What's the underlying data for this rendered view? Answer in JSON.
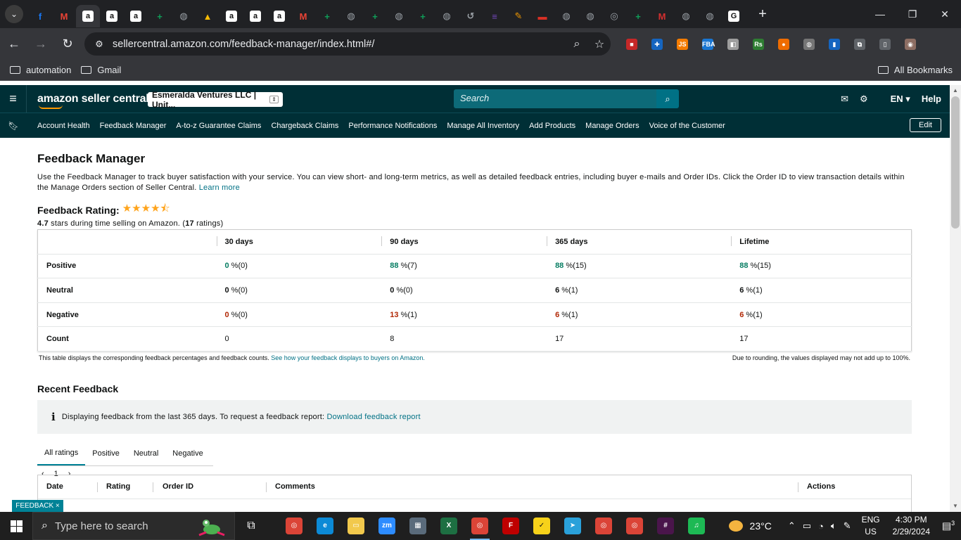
{
  "browser": {
    "url": "sellercentral.amazon.com/feedback-manager/index.html#/",
    "tabs": [
      {
        "icon": "facebook-icon",
        "color": "#1877f2",
        "glyph": "f"
      },
      {
        "icon": "gmail-icon",
        "color": "#ea4335",
        "glyph": "M"
      },
      {
        "icon": "amazon-icon",
        "color": "#ffffff",
        "glyph": "a",
        "active": true
      },
      {
        "icon": "amazon-icon",
        "color": "#ffffff",
        "glyph": "a"
      },
      {
        "icon": "amazon-icon",
        "color": "#ffffff",
        "glyph": "a"
      },
      {
        "icon": "sheets-icon",
        "color": "#0f9d58",
        "glyph": "+"
      },
      {
        "icon": "globe-icon",
        "color": "#9aa0a6",
        "glyph": "◍"
      },
      {
        "icon": "drive-icon",
        "color": "#fbbc04",
        "glyph": "▲"
      },
      {
        "icon": "amazon-icon",
        "color": "#ffffff",
        "glyph": "a"
      },
      {
        "icon": "amazon-icon",
        "color": "#ffffff",
        "glyph": "a"
      },
      {
        "icon": "amazon-icon",
        "color": "#ffffff",
        "glyph": "a"
      },
      {
        "icon": "gmail-icon",
        "color": "#ea4335",
        "glyph": "M"
      },
      {
        "icon": "sheets-icon",
        "color": "#0f9d58",
        "glyph": "+"
      },
      {
        "icon": "globe-icon",
        "color": "#9aa0a6",
        "glyph": "◍"
      },
      {
        "icon": "sheets-icon",
        "color": "#0f9d58",
        "glyph": "+"
      },
      {
        "icon": "globe-icon",
        "color": "#9aa0a6",
        "glyph": "◍"
      },
      {
        "icon": "sheets-icon",
        "color": "#0f9d58",
        "glyph": "+"
      },
      {
        "icon": "globe-icon",
        "color": "#9aa0a6",
        "glyph": "◍"
      },
      {
        "icon": "history-icon",
        "color": "#9aa0a6",
        "glyph": "↺"
      },
      {
        "icon": "forms-icon",
        "color": "#7248b9",
        "glyph": "≡"
      },
      {
        "icon": "tool-icon",
        "color": "#f29900",
        "glyph": "✎"
      },
      {
        "icon": "flag-icon",
        "color": "#d93025",
        "glyph": "▬"
      },
      {
        "icon": "globe-icon",
        "color": "#9aa0a6",
        "glyph": "◍"
      },
      {
        "icon": "globe-icon",
        "color": "#9aa0a6",
        "glyph": "◍"
      },
      {
        "icon": "chrome-icon",
        "color": "#9aa0a6",
        "glyph": "◎"
      },
      {
        "icon": "sheets-icon",
        "color": "#0f9d58",
        "glyph": "+"
      },
      {
        "icon": "mail-m-icon",
        "color": "#d32f2f",
        "glyph": "M"
      },
      {
        "icon": "globe-icon",
        "color": "#9aa0a6",
        "glyph": "◍"
      },
      {
        "icon": "globe-icon",
        "color": "#9aa0a6",
        "glyph": "◍"
      },
      {
        "icon": "google-icon",
        "color": "#ffffff",
        "glyph": "G"
      }
    ],
    "extensions": [
      {
        "icon": "ext-red-icon",
        "color": "#c62828",
        "glyph": "■"
      },
      {
        "icon": "ext-blue-icon",
        "color": "#1565c0",
        "glyph": "✚"
      },
      {
        "icon": "ext-js-icon",
        "color": "#f57c00",
        "glyph": "JS"
      },
      {
        "icon": "ext-fba-icon",
        "color": "#1976d2",
        "glyph": "FBA"
      },
      {
        "icon": "ext-doc-icon",
        "color": "#9e9e9e",
        "glyph": "◧"
      },
      {
        "icon": "ext-rs-icon",
        "color": "#2e7d32",
        "glyph": "Rs"
      },
      {
        "icon": "ext-orange-icon",
        "color": "#ef6c00",
        "glyph": "●"
      },
      {
        "icon": "ext-globe-icon",
        "color": "#757575",
        "glyph": "◍"
      },
      {
        "icon": "ext-chart-icon",
        "color": "#1565c0",
        "glyph": "▮"
      },
      {
        "icon": "extensions-puzzle-icon",
        "color": "#5f6368",
        "glyph": "⧉"
      },
      {
        "icon": "sidepanel-icon",
        "color": "#5f6368",
        "glyph": "▯"
      },
      {
        "icon": "profile-avatar-icon",
        "color": "#8d6e63",
        "glyph": "◉"
      }
    ],
    "bookmarks": [
      "automation",
      "Gmail"
    ],
    "all_bookmarks": "All Bookmarks"
  },
  "header": {
    "logo": "amazon seller central",
    "account": "Esmeralda Ventures LLC | Unit...",
    "search_placeholder": "Search",
    "lang": "EN",
    "help": "Help"
  },
  "nav": {
    "links": [
      "Account Health",
      "Feedback Manager",
      "A-to-z Guarantee Claims",
      "Chargeback Claims",
      "Performance Notifications",
      "Manage All Inventory",
      "Add Products",
      "Manage Orders",
      "Voice of the Customer"
    ],
    "edit": "Edit"
  },
  "page": {
    "title": "Feedback Manager",
    "intro": "Use the Feedback Manager to track buyer satisfaction with your service. You can view short- and long-term metrics, as well as detailed feedback entries, including buyer e-mails and Order IDs. Click the Order ID to view transaction details within the Manage Orders section of Seller Central.",
    "learn_more": "Learn more",
    "rating_label": "Feedback Rating:",
    "rating_stars": 4.5,
    "rating_value": "4.7",
    "rating_text_mid": " stars during time selling on Amazon. (",
    "rating_count": "17",
    "rating_text_end": " ratings)"
  },
  "summary": {
    "columns": [
      "30 days",
      "90 days",
      "365 days",
      "Lifetime"
    ],
    "rows": [
      {
        "label": "Positive",
        "tone": "g",
        "cells": [
          [
            "0",
            " %(0)"
          ],
          [
            "88",
            " %(7)"
          ],
          [
            "88",
            " %(15)"
          ],
          [
            "88",
            " %(15)"
          ]
        ]
      },
      {
        "label": "Neutral",
        "tone": "k",
        "cells": [
          [
            "0",
            " %(0)"
          ],
          [
            "0",
            " %(0)"
          ],
          [
            "6",
            " %(1)"
          ],
          [
            "6",
            " %(1)"
          ]
        ]
      },
      {
        "label": "Negative",
        "tone": "r",
        "cells": [
          [
            "0",
            " %(0)"
          ],
          [
            "13",
            " %(1)"
          ],
          [
            "6",
            " %(1)"
          ],
          [
            "6",
            " %(1)"
          ]
        ]
      },
      {
        "label": "Count",
        "tone": "plain",
        "cells": [
          [
            "0",
            ""
          ],
          [
            "8",
            ""
          ],
          [
            "17",
            ""
          ],
          [
            "17",
            ""
          ]
        ]
      }
    ],
    "note_left": "This table displays the corresponding feedback percentages and feedback counts.",
    "note_link": "See how your feedback displays to buyers on Amazon.",
    "note_right": "Due to rounding, the values displayed may not add up to 100%."
  },
  "recent": {
    "title": "Recent Feedback",
    "info": "Displaying feedback from the last 365 days. To request a feedback report:",
    "info_link": "Download feedback report",
    "tabs": [
      "All ratings",
      "Positive",
      "Neutral",
      "Negative"
    ],
    "page": "1",
    "columns": [
      "Date",
      "Rating",
      "Order ID",
      "Comments",
      "Actions"
    ]
  },
  "badge": "FEEDBACK ×",
  "taskbar": {
    "search": "Type here to search",
    "apps": [
      {
        "icon": "chrome-icon",
        "color": "#db4437",
        "glyph": "◎"
      },
      {
        "icon": "edge-icon",
        "color": "#0c8ad6",
        "glyph": "e"
      },
      {
        "icon": "explorer-icon",
        "color": "#f2c94c",
        "glyph": "▭"
      },
      {
        "icon": "zoom-icon",
        "color": "#2d8cff",
        "glyph": "zm"
      },
      {
        "icon": "calculator-icon",
        "color": "#5a6b7b",
        "glyph": "▦"
      },
      {
        "icon": "excel-icon",
        "color": "#1d6f42",
        "glyph": "X"
      },
      {
        "icon": "chrome-profile-icon",
        "color": "#db4437",
        "glyph": "◎",
        "on": true
      },
      {
        "icon": "filezilla-icon",
        "color": "#bf0000",
        "glyph": "F"
      },
      {
        "icon": "sticky-notes-icon",
        "color": "#f7d21a",
        "glyph": "✓"
      },
      {
        "icon": "telegram-icon",
        "color": "#2aa1da",
        "glyph": "➤"
      },
      {
        "icon": "chrome-profile-icon",
        "color": "#db4437",
        "glyph": "◎"
      },
      {
        "icon": "chrome-profile-icon",
        "color": "#db4437",
        "glyph": "◎"
      },
      {
        "icon": "slack-icon",
        "color": "#4a154b",
        "glyph": "#"
      },
      {
        "icon": "spotify-icon",
        "color": "#1db954",
        "glyph": "♫"
      }
    ],
    "temp": "23°C",
    "lang1": "ENG",
    "lang2": "US",
    "time": "4:30 PM",
    "date": "2/29/2024",
    "notif_count": "3"
  }
}
